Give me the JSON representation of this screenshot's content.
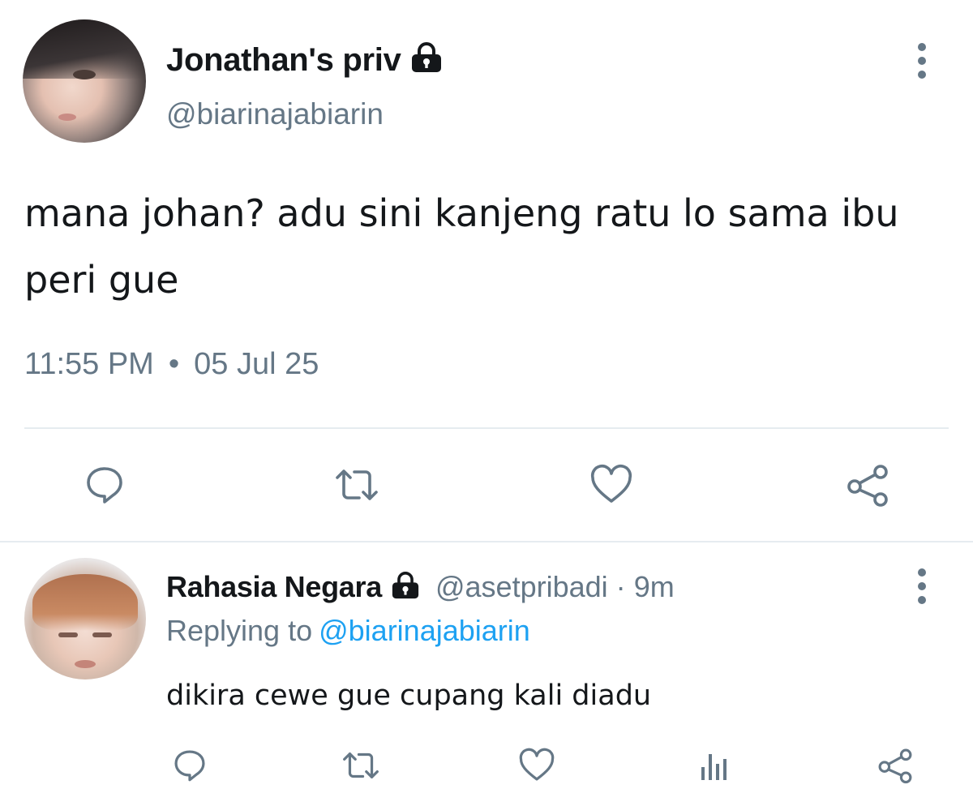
{
  "main_tweet": {
    "display_name": "Jonathan's priv",
    "handle": "@biarinajabiarin",
    "text": "mana johan? adu sini kanjeng ratu lo sama ibu peri gue",
    "time": "11:55 PM",
    "separator": "•",
    "date": "05 Jul 25",
    "icons": [
      "lock-icon",
      "more-vertical-icon",
      "reply-icon",
      "retweet-icon",
      "like-icon",
      "share-icon"
    ]
  },
  "reply_tweet": {
    "display_name": "Rahasia Negara",
    "handle": "@asetpribadi",
    "separator": "·",
    "time_ago": "9m",
    "replying_prefix": "Replying to",
    "replying_to": "@biarinajabiarin",
    "text": "dikira cewe gue cupang kali diadu",
    "icons": [
      "lock-icon",
      "more-vertical-icon",
      "reply-icon",
      "retweet-icon",
      "like-icon",
      "analytics-icon",
      "share-icon"
    ]
  },
  "colors": {
    "text_primary": "#14171a",
    "text_secondary": "#657786",
    "icon": "#657786",
    "link": "#1da1f2",
    "divider": "#e6ecf0",
    "background": "#ffffff"
  }
}
